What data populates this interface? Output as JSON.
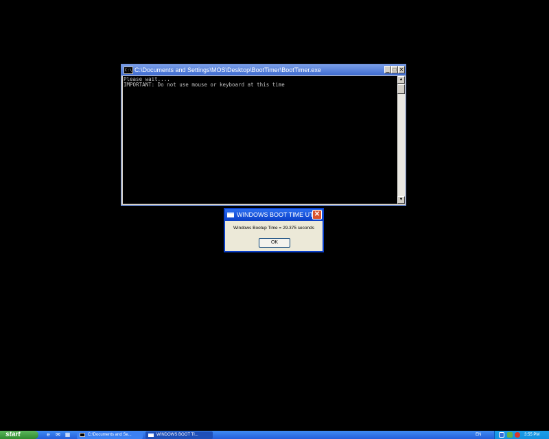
{
  "console": {
    "icon": "cmd-icon",
    "icon_text": "C:\\",
    "title": "C:\\Documents and Settings\\MOS\\Desktop\\BootTimer\\BootTimer.exe",
    "minimize": "_",
    "maximize": "□",
    "close": "✕",
    "lines": [
      "Please wait....",
      "IMPORTANT: Do not use mouse or keyboard at this time"
    ],
    "scroll_up": "▲",
    "scroll_down": "▼"
  },
  "dialog": {
    "title": "WINDOWS BOOT TIME UTI...",
    "close": "✕",
    "message": "Windows Bootup Time =  29.375  seconds",
    "ok_label": "OK"
  },
  "taskbar": {
    "start_label": "start",
    "quick_launch": [
      "e",
      "✉",
      "▦"
    ],
    "tasks": [
      {
        "label": "C:\\Documents and Se...",
        "active": false
      },
      {
        "label": "WINDOWS BOOT TI...",
        "active": true
      }
    ],
    "language": "EN",
    "clock": "3:55 PM"
  },
  "colors": {
    "desktop": "#000000",
    "console_title": "#3e6bd0",
    "dialog_title": "#0a3fc8",
    "taskbar": "#245edb",
    "start_button": "#2f8a2f"
  }
}
